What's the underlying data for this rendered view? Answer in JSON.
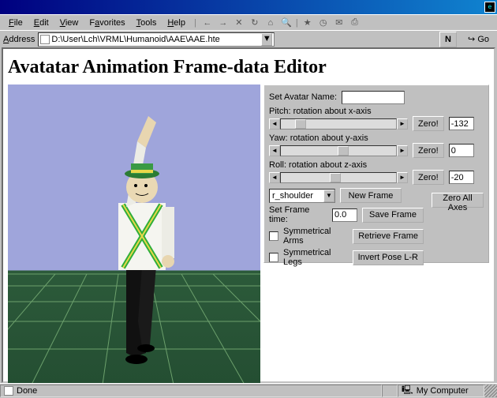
{
  "menu": {
    "file": "File",
    "edit": "Edit",
    "view": "View",
    "favorites": "Favorites",
    "tools": "Tools",
    "help": "Help"
  },
  "address": {
    "label": "Address",
    "value": "D:\\User\\Lch\\VRML\\Humanoid\\AAE\\AAE.hte",
    "go": "Go"
  },
  "page": {
    "title": "Avatatar Animation Frame-data Editor"
  },
  "panel": {
    "setAvatarName": "Set Avatar Name:",
    "avatarName": "",
    "pitchLabel": "Pitch: rotation about x-axis",
    "yawLabel": "Yaw: rotation about y-axis",
    "rollLabel": "Roll: rotation about z-axis",
    "zero": "Zero!",
    "pitchVal": "-132",
    "yawVal": "0",
    "rollVal": "-20",
    "jointSelected": "r_shoulder",
    "newFrame": "New Frame",
    "zeroAll": "Zero All Axes",
    "setFrameTime": "Set Frame time:",
    "frameTime": "0.0",
    "saveFrame": "Save Frame",
    "symArms": "Symmetrical Arms",
    "retrieve": "Retrieve Frame",
    "symLegs": "Symmetrical Legs",
    "invert": "Invert Pose L-R"
  },
  "status": {
    "done": "Done",
    "zone": "My Computer"
  }
}
